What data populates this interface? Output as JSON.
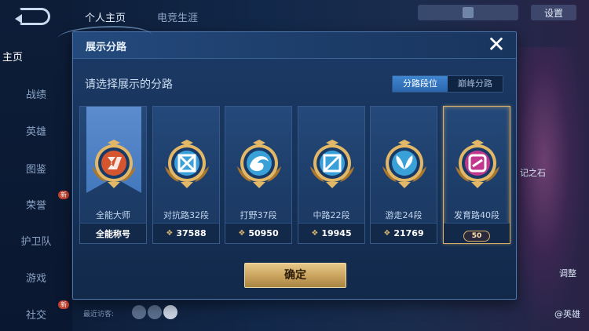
{
  "background": {
    "top_tabs": [
      "个人主页",
      "电竞生涯"
    ],
    "sidebar": [
      {
        "label": "主页",
        "new": false
      },
      {
        "label": "战绩",
        "new": false
      },
      {
        "label": "英雄",
        "new": false
      },
      {
        "label": "图鉴",
        "new": false
      },
      {
        "label": "荣誉",
        "new": true
      },
      {
        "label": "护卫队",
        "new": false
      },
      {
        "label": "游戏",
        "new": false
      },
      {
        "label": "社交",
        "new": true
      }
    ],
    "new_badge": "新",
    "settings_label": "设置",
    "right_labels": [
      "记之石",
      "调整",
      "@英雄"
    ],
    "visitor_label": "最近访客:"
  },
  "modal": {
    "title": "展示分路",
    "close_symbol": "✕",
    "subtitle": "请选择展示的分路",
    "toggle": [
      "分路段位",
      "巅峰分路"
    ],
    "toggle_active": 0,
    "confirm_label": "确定",
    "cards": [
      {
        "name": "全能大师",
        "footer": "全能称号",
        "has_score": false,
        "color": "#d4552e",
        "icon": "allround-master-emblem-icon"
      },
      {
        "name": "对抗路32段",
        "footer": "37588",
        "has_score": true,
        "color": "#3aa0d8",
        "icon": "clash-lane-emblem-icon"
      },
      {
        "name": "打野37段",
        "footer": "50950",
        "has_score": true,
        "color": "#3aa0d8",
        "icon": "jungle-dragon-emblem-icon"
      },
      {
        "name": "中路22段",
        "footer": "19945",
        "has_score": true,
        "color": "#3aa0d8",
        "icon": "mid-lane-emblem-icon"
      },
      {
        "name": "游走24段",
        "footer": "21769",
        "has_score": true,
        "color": "#3aa0d8",
        "icon": "roam-emblem-icon"
      },
      {
        "name": "发育路40段",
        "footer": "",
        "has_score": false,
        "color": "#c0398e",
        "icon": "farm-lane-emblem-icon",
        "selected": true,
        "badge": "50"
      }
    ]
  }
}
